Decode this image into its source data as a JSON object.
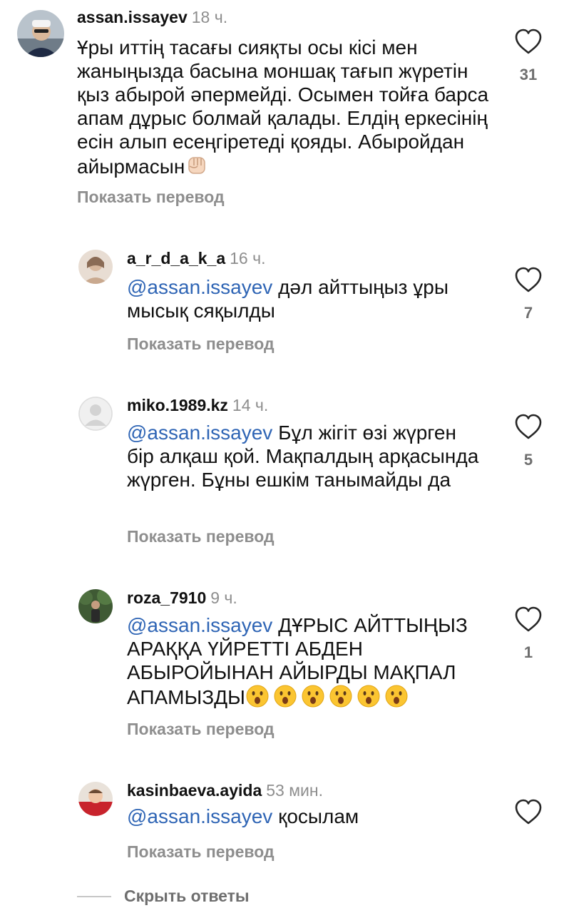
{
  "comments": [
    {
      "username": "assan.issayev",
      "time": "18 ч.",
      "mention": "",
      "text": "Ұры иттің тасағы сияқты осы кісі мен жаныңызда басына моншақ тағып жүретін қыз абырой әпермейді. Осымен тойға барса апам дұрыс болмай қалады. Елдің еркесінің есін алып есеңгіретеді қояды. Абыройдан айырмасын",
      "emoji": "raised-fist-emoji",
      "translate": "Показать перевод",
      "likes": "31"
    },
    {
      "username": "a_r_d_a_k_a",
      "time": "16 ч.",
      "mention": "@assan.issayev",
      "text": " дәл айттыңыз ұры мысық сяқылды",
      "translate": "Показать перевод",
      "likes": "7"
    },
    {
      "username": "miko.1989.kz",
      "time": "14 ч.",
      "mention": "@assan.issayev",
      "text": " Бұл жігіт өзі жүрген бір алқаш қой. Мақпалдың арқасында жүрген. Бұны ешкім танымайды да",
      "translate": "Показать перевод",
      "likes": "5"
    },
    {
      "username": "roza_7910",
      "time": "9 ч.",
      "mention": "@assan.issayev",
      "text": " ДҰРЫС АЙТТЫҢЫЗ АРАҚҚА ҮЙРЕТТІ АБДЕН АБЫРОЙЫНАН АЙЫРДЫ МАҚПАЛ АПАМЫЗДЫ",
      "emoji": "astonished-face-emoji",
      "emoji_count": 6,
      "translate": "Показать перевод",
      "likes": "1"
    },
    {
      "username": "kasinbaeva.ayida",
      "time": "53 мин.",
      "mention": "@assan.issayev",
      "text": " қосылам",
      "translate": "Показать перевод",
      "likes": ""
    }
  ],
  "hide_replies": "Скрыть ответы",
  "colors": {
    "mention": "#2f65b5",
    "secondary_text": "#8e8e8e",
    "primary_text": "#111111"
  },
  "icons": {
    "like": "heart-outline-icon"
  }
}
